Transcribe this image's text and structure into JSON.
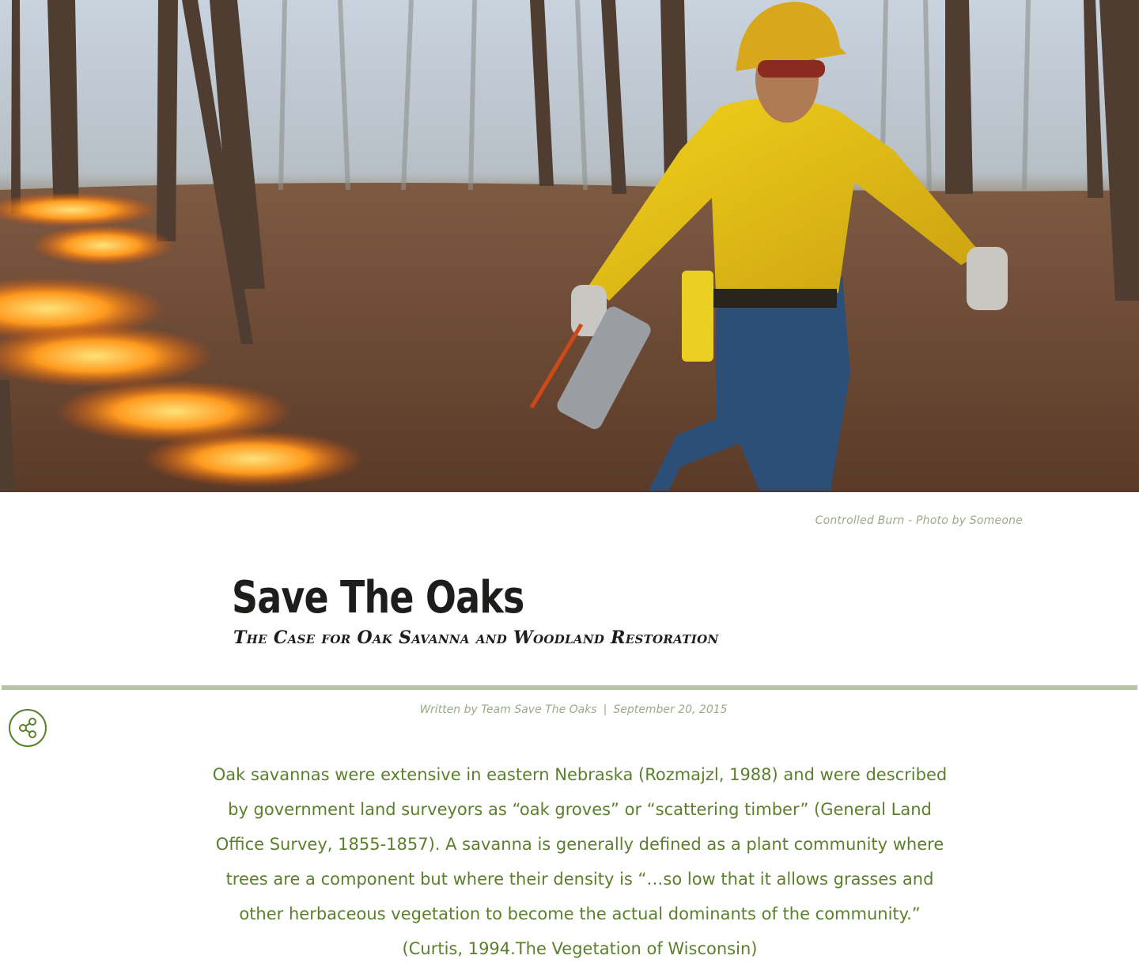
{
  "hero": {
    "caption": "Controlled Burn - Photo by Someone"
  },
  "article": {
    "title": "Save The Oaks",
    "subtitle": "The Case for Oak Savanna and Woodland Restoration",
    "byline": {
      "author": "Written by Team Save The Oaks",
      "separator": "|",
      "date": "September 20, 2015"
    },
    "body": "Oak savannas were extensive in eastern Nebraska (Rozmajzl, 1988) and were described by government land surveyors as “oak groves” or “scattering timber” (General Land Office Survey, 1855-1857). A savanna is generally defined as a plant community where trees are a component but where their density is “…so low that it allows grasses and other herbaceous vegetation to become the actual dominants of the community.” (Curtis, 1994.The Vegetation of Wisconsin)"
  },
  "share": {
    "icon": "share-icon"
  },
  "colors": {
    "accent_green": "#5b7f2c",
    "muted_green": "#9aaa88",
    "divider": "#b8c6a6",
    "title": "#1d1d1b"
  }
}
